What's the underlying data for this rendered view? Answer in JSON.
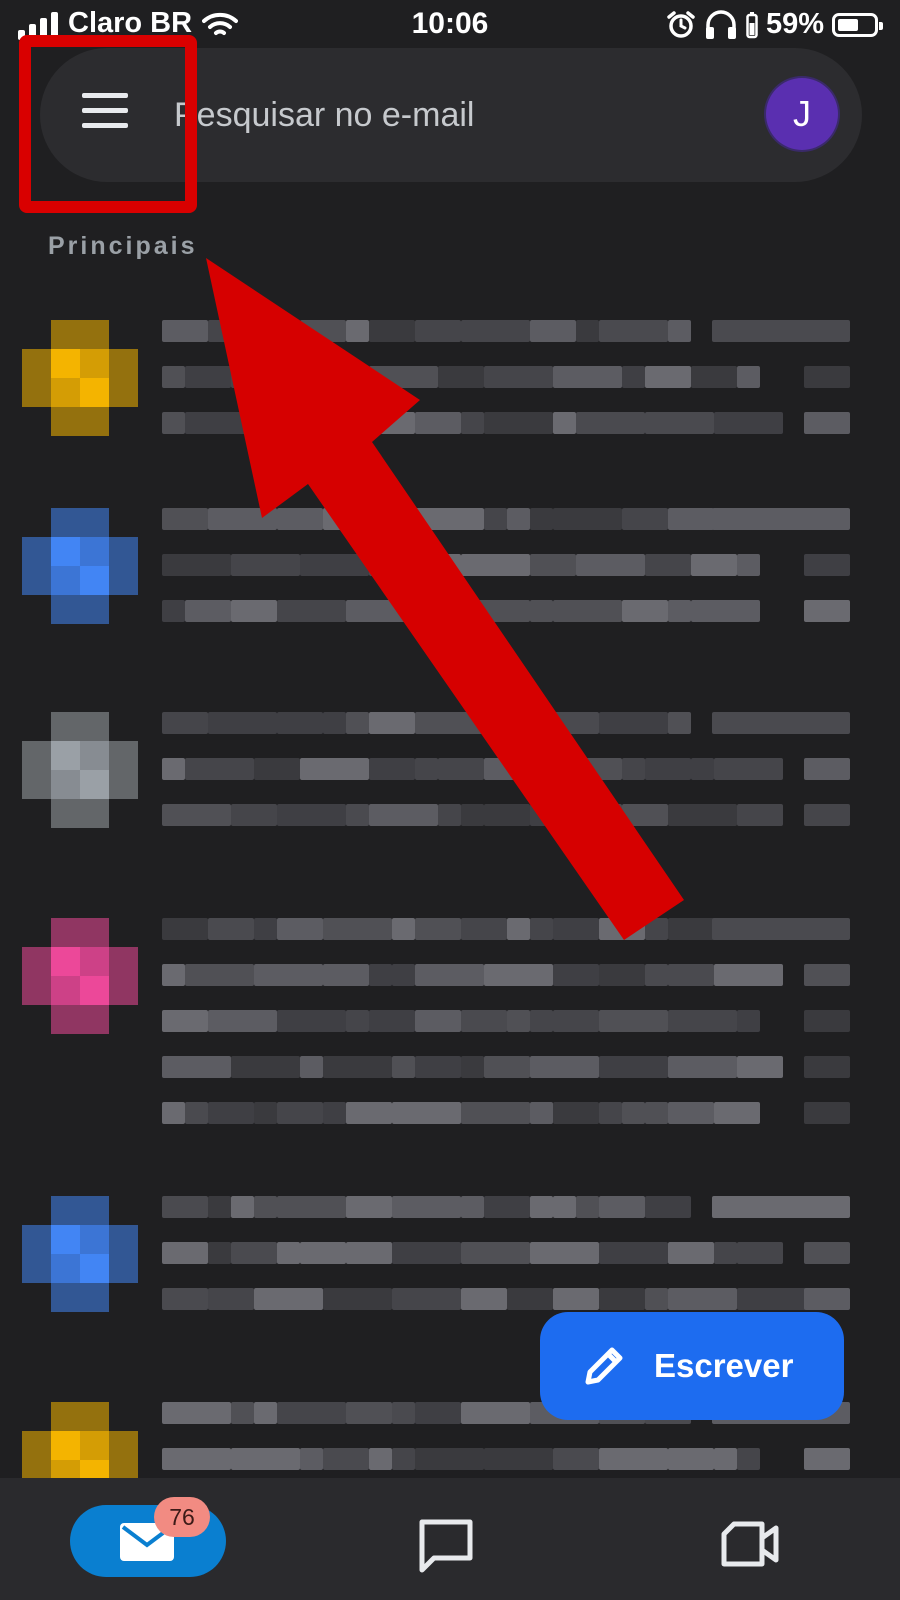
{
  "status_bar": {
    "carrier": "Claro BR",
    "time": "10:06",
    "battery_percent": "59%",
    "battery_level": 0.59,
    "icons": [
      "signal-icon",
      "wifi-icon",
      "alarm-icon",
      "headphones-icon",
      "battery-icon"
    ]
  },
  "search": {
    "placeholder": "Pesquisar no e-mail",
    "avatar_initial": "J",
    "menu_icon": "menu-icon"
  },
  "inbox": {
    "section_label": "Principais",
    "emails": [
      {
        "avatar_color": "#f4b400"
      },
      {
        "avatar_color": "#4285f4"
      },
      {
        "avatar_color": "#9aa0a6"
      },
      {
        "avatar_color": "#ec4899"
      },
      {
        "avatar_color": "#4285f4"
      },
      {
        "avatar_color": "#f4b400"
      }
    ]
  },
  "compose": {
    "label": "Escrever",
    "icon": "pencil-icon"
  },
  "bottom_nav": {
    "mail_badge": "76",
    "items": [
      "mail-icon",
      "chat-icon",
      "meet-icon"
    ]
  },
  "colors": {
    "background": "#1f1f21",
    "accent": "#1d6cf0",
    "annotation": "#d90000"
  }
}
